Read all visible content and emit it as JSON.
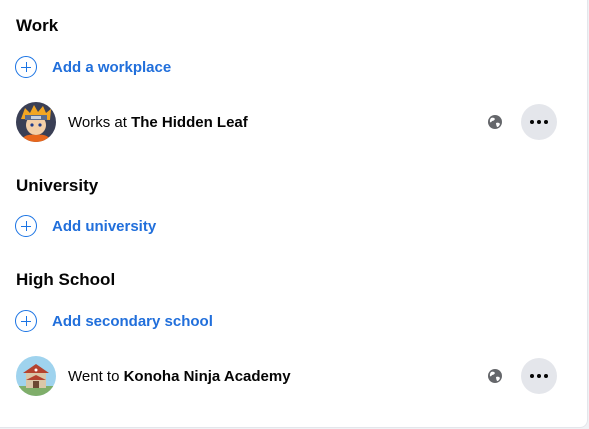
{
  "work": {
    "heading": "Work",
    "add_label": "Add a workplace",
    "entry": {
      "prefix": "Works at",
      "place": "The Hidden Leaf"
    }
  },
  "university": {
    "heading": "University",
    "add_label": "Add university"
  },
  "high_school": {
    "heading": "High School",
    "add_label": "Add secondary school",
    "entry": {
      "prefix": "Went to",
      "place": "Konoha Ninja Academy"
    }
  },
  "icons": {
    "add": "plus-circle-icon",
    "privacy": "globe-icon",
    "more": "more-dots-icon"
  },
  "colors": {
    "accent": "#216fdb",
    "button_bg": "#e4e6eb",
    "text": "#050505"
  }
}
